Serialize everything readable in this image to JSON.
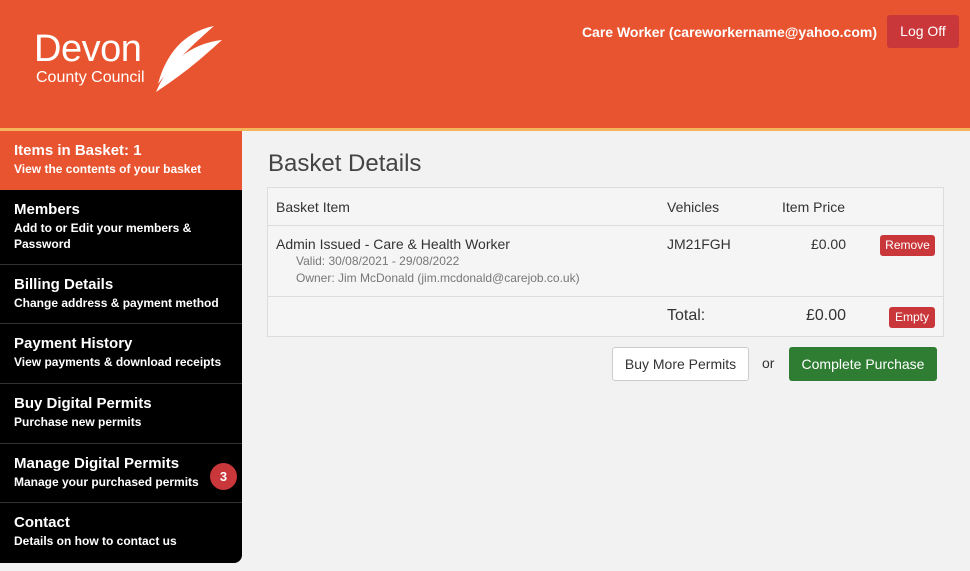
{
  "header": {
    "logo_line1": "Devon",
    "logo_line2": "County Council",
    "user_label": "Care Worker (careworkername@yahoo.com)",
    "logoff_label": "Log Off",
    "brand_color": "#e8542f"
  },
  "sidebar": {
    "items": [
      {
        "title": "Items in Basket: 1",
        "subtitle": "View the contents of your basket",
        "active": true
      },
      {
        "title": "Members",
        "subtitle": "Add to or Edit your members & Password"
      },
      {
        "title": "Billing Details",
        "subtitle": "Change address & payment method"
      },
      {
        "title": "Payment History",
        "subtitle": "View payments & download receipts"
      },
      {
        "title": "Buy Digital Permits",
        "subtitle": "Purchase new permits"
      },
      {
        "title": "Manage Digital Permits",
        "subtitle": "Manage your purchased permits",
        "badge": "3"
      },
      {
        "title": "Contact",
        "subtitle": "Details on how to contact us"
      }
    ]
  },
  "main": {
    "title": "Basket Details",
    "table": {
      "headers": [
        "Basket Item",
        "Vehicles",
        "Item Price"
      ],
      "rows": [
        {
          "name": "Admin Issued - Care & Health Worker",
          "valid": "Valid: 30/08/2021 - 29/08/2022",
          "owner": "Owner: Jim McDonald (jim.mcdonald@carejob.co.uk)",
          "vehicle": "JM21FGH",
          "price": "£0.00",
          "remove_label": "Remove"
        }
      ],
      "total_label": "Total:",
      "total_value": "£0.00",
      "empty_label": "Empty"
    },
    "buy_more_label": "Buy More Permits",
    "or_label": "or",
    "complete_label": "Complete Purchase"
  }
}
